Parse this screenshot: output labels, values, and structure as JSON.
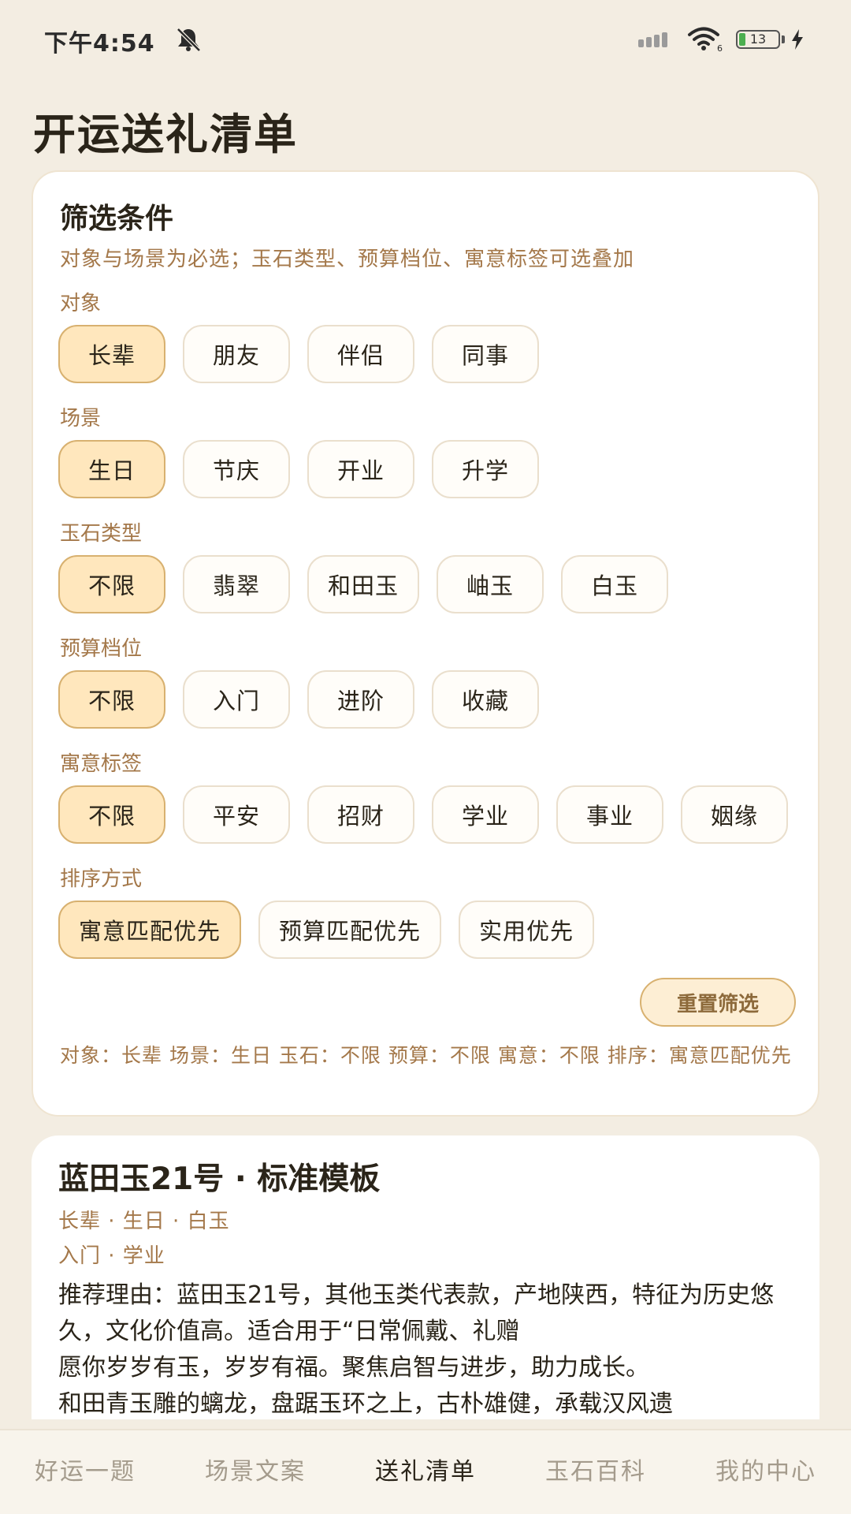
{
  "status_bar": {
    "time": "下午4:54",
    "battery": "13"
  },
  "page_title": "开运送礼清单",
  "filter": {
    "heading": "筛选条件",
    "hint": "对象与场景为必选；玉石类型、预算档位、寓意标签可选叠加",
    "groups": [
      {
        "label": "对象",
        "options": [
          "长辈",
          "朋友",
          "伴侣",
          "同事"
        ],
        "selected": 0
      },
      {
        "label": "场景",
        "options": [
          "生日",
          "节庆",
          "开业",
          "升学"
        ],
        "selected": 0
      },
      {
        "label": "玉石类型",
        "options": [
          "不限",
          "翡翠",
          "和田玉",
          "岫玉",
          "白玉"
        ],
        "selected": 0
      },
      {
        "label": "预算档位",
        "options": [
          "不限",
          "入门",
          "进阶",
          "收藏"
        ],
        "selected": 0
      },
      {
        "label": "寓意标签",
        "options": [
          "不限",
          "平安",
          "招财",
          "学业",
          "事业",
          "姻缘"
        ],
        "selected": 0
      },
      {
        "label": "排序方式",
        "options": [
          "寓意匹配优先",
          "预算匹配优先",
          "实用优先"
        ],
        "selected": 0
      }
    ],
    "reset_label": "重置筛选",
    "summary": "对象：长辈  场景：生日  玉石：不限  预算：不限  寓意：不限  排序：寓意匹配优先"
  },
  "result": {
    "title": "蓝田玉21号 · 标准模板",
    "tags_line1": "长辈 · 生日 · 白玉",
    "tags_line2": "入门 · 学业",
    "reason": "推荐理由：蓝田玉21号，其他玉类代表款，产地陕西，特征为历史悠久，文化价值高。适合用于“日常佩戴、礼赠",
    "blessing": "愿你岁岁有玉，岁岁有福。聚焦启智与进步，助力成长。",
    "description": "和田青玉雕的螭龙，盘踞玉环之上，古朴雄健，承载汉风遗"
  },
  "bottom_nav": {
    "items": [
      "好运一题",
      "场景文案",
      "送礼清单",
      "玉石百科",
      "我的中心"
    ],
    "active": 2
  }
}
